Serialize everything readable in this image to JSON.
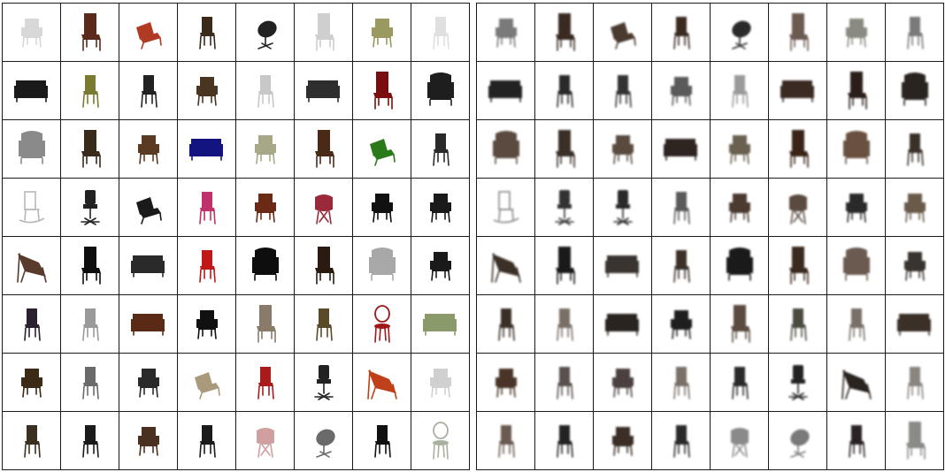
{
  "panels": [
    {
      "id": "input-renders",
      "blur": false,
      "rows": [
        [
          {
            "type": "armchair",
            "color": "#d8d8d8"
          },
          {
            "type": "highback",
            "color": "#5a2a1a"
          },
          {
            "type": "lounge",
            "color": "#b03a22"
          },
          {
            "type": "side",
            "color": "#3a2a1a"
          },
          {
            "type": "egg",
            "color": "#222222"
          },
          {
            "type": "highback",
            "color": "#cfcfcf"
          },
          {
            "type": "armchair",
            "color": "#9a9a60"
          },
          {
            "type": "side",
            "color": "#e0e0e0"
          }
        ],
        [
          {
            "type": "sofa",
            "color": "#1a1a1a"
          },
          {
            "type": "side",
            "color": "#7a7a30"
          },
          {
            "type": "side",
            "color": "#222222"
          },
          {
            "type": "armchair",
            "color": "#4a3520"
          },
          {
            "type": "side",
            "color": "#c8c8c8"
          },
          {
            "type": "sofa",
            "color": "#2e2e2e"
          },
          {
            "type": "highback",
            "color": "#7a0e0e"
          },
          {
            "type": "wing",
            "color": "#1e1e1e"
          }
        ],
        [
          {
            "type": "wing",
            "color": "#8a8a8a"
          },
          {
            "type": "highback",
            "color": "#3a2a1a"
          },
          {
            "type": "armchair",
            "color": "#5a3a22"
          },
          {
            "type": "sofa",
            "color": "#141480"
          },
          {
            "type": "armchair",
            "color": "#a8a888"
          },
          {
            "type": "highback",
            "color": "#4a2a16"
          },
          {
            "type": "lounge",
            "color": "#2a7a1a"
          },
          {
            "type": "side",
            "color": "#2a2a2a"
          }
        ],
        [
          {
            "type": "rocker",
            "color": "#b8b8b8"
          },
          {
            "type": "office",
            "color": "#222222"
          },
          {
            "type": "lounge",
            "color": "#1a1a1a"
          },
          {
            "type": "side",
            "color": "#c0306a"
          },
          {
            "type": "armchair",
            "color": "#6a2a16"
          },
          {
            "type": "shell",
            "color": "#9a2a3a"
          },
          {
            "type": "armchair",
            "color": "#111111"
          },
          {
            "type": "armchair",
            "color": "#1a1a1a"
          }
        ],
        [
          {
            "type": "butterfly",
            "color": "#5a3a2a"
          },
          {
            "type": "highback",
            "color": "#0e0e0e"
          },
          {
            "type": "sofa",
            "color": "#2a2a2a"
          },
          {
            "type": "side",
            "color": "#c01818"
          },
          {
            "type": "wing",
            "color": "#0e0e0e"
          },
          {
            "type": "highback",
            "color": "#2a1a10"
          },
          {
            "type": "wing",
            "color": "#a8a8a8"
          },
          {
            "type": "armchair",
            "color": "#1a1a1a"
          }
        ],
        [
          {
            "type": "side",
            "color": "#2a2030"
          },
          {
            "type": "side",
            "color": "#9a9a9a"
          },
          {
            "type": "sofa",
            "color": "#5a2a16"
          },
          {
            "type": "armchair",
            "color": "#111111"
          },
          {
            "type": "highback",
            "color": "#8a7a6a"
          },
          {
            "type": "side",
            "color": "#5a4a2a"
          },
          {
            "type": "bistro",
            "color": "#a01818"
          },
          {
            "type": "sofa",
            "color": "#8a9a6a"
          }
        ],
        [
          {
            "type": "armchair",
            "color": "#3a2a16"
          },
          {
            "type": "side",
            "color": "#6a6a6a"
          },
          {
            "type": "armchair",
            "color": "#2a2a2a"
          },
          {
            "type": "lounge",
            "color": "#a89a7a"
          },
          {
            "type": "side",
            "color": "#aa1a1a"
          },
          {
            "type": "office",
            "color": "#222222"
          },
          {
            "type": "butterfly",
            "color": "#c0401a"
          },
          {
            "type": "armchair",
            "color": "#d0d0d0"
          }
        ],
        [
          {
            "type": "side",
            "color": "#3a3020"
          },
          {
            "type": "side",
            "color": "#1a1a1a"
          },
          {
            "type": "armchair",
            "color": "#4a3020"
          },
          {
            "type": "side",
            "color": "#1a1a1a"
          },
          {
            "type": "shell",
            "color": "#d0a0a0"
          },
          {
            "type": "egg",
            "color": "#6a6a6a"
          },
          {
            "type": "side",
            "color": "#111111"
          },
          {
            "type": "bistro",
            "color": "#a8b0a0"
          }
        ]
      ]
    },
    {
      "id": "reconstructions",
      "blur": true,
      "rows": [
        [
          {
            "type": "armchair",
            "color": "#7a7a7a"
          },
          {
            "type": "highback",
            "color": "#3a2a22"
          },
          {
            "type": "lounge",
            "color": "#4a3a30"
          },
          {
            "type": "side",
            "color": "#3a2a20"
          },
          {
            "type": "egg",
            "color": "#2a2a2a"
          },
          {
            "type": "highback",
            "color": "#6a5a50"
          },
          {
            "type": "armchair",
            "color": "#8a8a80"
          },
          {
            "type": "side",
            "color": "#7a7a7a"
          }
        ],
        [
          {
            "type": "sofa",
            "color": "#222222"
          },
          {
            "type": "side",
            "color": "#2a2a2a"
          },
          {
            "type": "side",
            "color": "#333333"
          },
          {
            "type": "armchair",
            "color": "#5a5a5a"
          },
          {
            "type": "side",
            "color": "#9a9a9a"
          },
          {
            "type": "sofa",
            "color": "#3a2a22"
          },
          {
            "type": "highback",
            "color": "#2a1e1a"
          },
          {
            "type": "wing",
            "color": "#2a2420"
          }
        ],
        [
          {
            "type": "wing",
            "color": "#5a4a40"
          },
          {
            "type": "highback",
            "color": "#3a3028"
          },
          {
            "type": "armchair",
            "color": "#5a4a40"
          },
          {
            "type": "sofa",
            "color": "#2e2420"
          },
          {
            "type": "armchair",
            "color": "#6a6050"
          },
          {
            "type": "highback",
            "color": "#3a2418"
          },
          {
            "type": "wing",
            "color": "#6a5040"
          },
          {
            "type": "side",
            "color": "#3a302a"
          }
        ],
        [
          {
            "type": "rocker",
            "color": "#8a8a8a"
          },
          {
            "type": "office",
            "color": "#333333"
          },
          {
            "type": "office",
            "color": "#2a2a2a"
          },
          {
            "type": "side",
            "color": "#5a5a5a"
          },
          {
            "type": "armchair",
            "color": "#4a3a30"
          },
          {
            "type": "shell",
            "color": "#5a4a40"
          },
          {
            "type": "armchair",
            "color": "#2a2a2a"
          },
          {
            "type": "armchair",
            "color": "#6a5a4a"
          }
        ],
        [
          {
            "type": "butterfly",
            "color": "#3a3028"
          },
          {
            "type": "highback",
            "color": "#1a1a1a"
          },
          {
            "type": "sofa",
            "color": "#3a3430"
          },
          {
            "type": "side",
            "color": "#3a3028"
          },
          {
            "type": "wing",
            "color": "#1a1a1a"
          },
          {
            "type": "highback",
            "color": "#3a2a20"
          },
          {
            "type": "wing",
            "color": "#6a5a50"
          },
          {
            "type": "armchair",
            "color": "#3a3430"
          }
        ],
        [
          {
            "type": "side",
            "color": "#3a3028"
          },
          {
            "type": "side",
            "color": "#7a7068"
          },
          {
            "type": "sofa",
            "color": "#2a2420"
          },
          {
            "type": "armchair",
            "color": "#1e1e1e"
          },
          {
            "type": "highback",
            "color": "#5a4a40"
          },
          {
            "type": "side",
            "color": "#4a4a40"
          },
          {
            "type": "side",
            "color": "#7a7068"
          },
          {
            "type": "sofa",
            "color": "#3a3028"
          }
        ],
        [
          {
            "type": "armchair",
            "color": "#4a3428"
          },
          {
            "type": "side",
            "color": "#5a5050"
          },
          {
            "type": "armchair",
            "color": "#4a4040"
          },
          {
            "type": "side",
            "color": "#7a7068"
          },
          {
            "type": "side",
            "color": "#2a2a2a"
          },
          {
            "type": "office",
            "color": "#222222"
          },
          {
            "type": "butterfly",
            "color": "#2a2420"
          },
          {
            "type": "side",
            "color": "#8a8580"
          }
        ],
        [
          {
            "type": "side",
            "color": "#6a5a50"
          },
          {
            "type": "side",
            "color": "#222222"
          },
          {
            "type": "armchair",
            "color": "#3a2e26"
          },
          {
            "type": "side",
            "color": "#2a2a2a"
          },
          {
            "type": "shell",
            "color": "#8a8a8a"
          },
          {
            "type": "egg",
            "color": "#7a7a7a"
          },
          {
            "type": "side",
            "color": "#2a2224"
          },
          {
            "type": "highback",
            "color": "#8a8a88"
          }
        ]
      ]
    }
  ]
}
